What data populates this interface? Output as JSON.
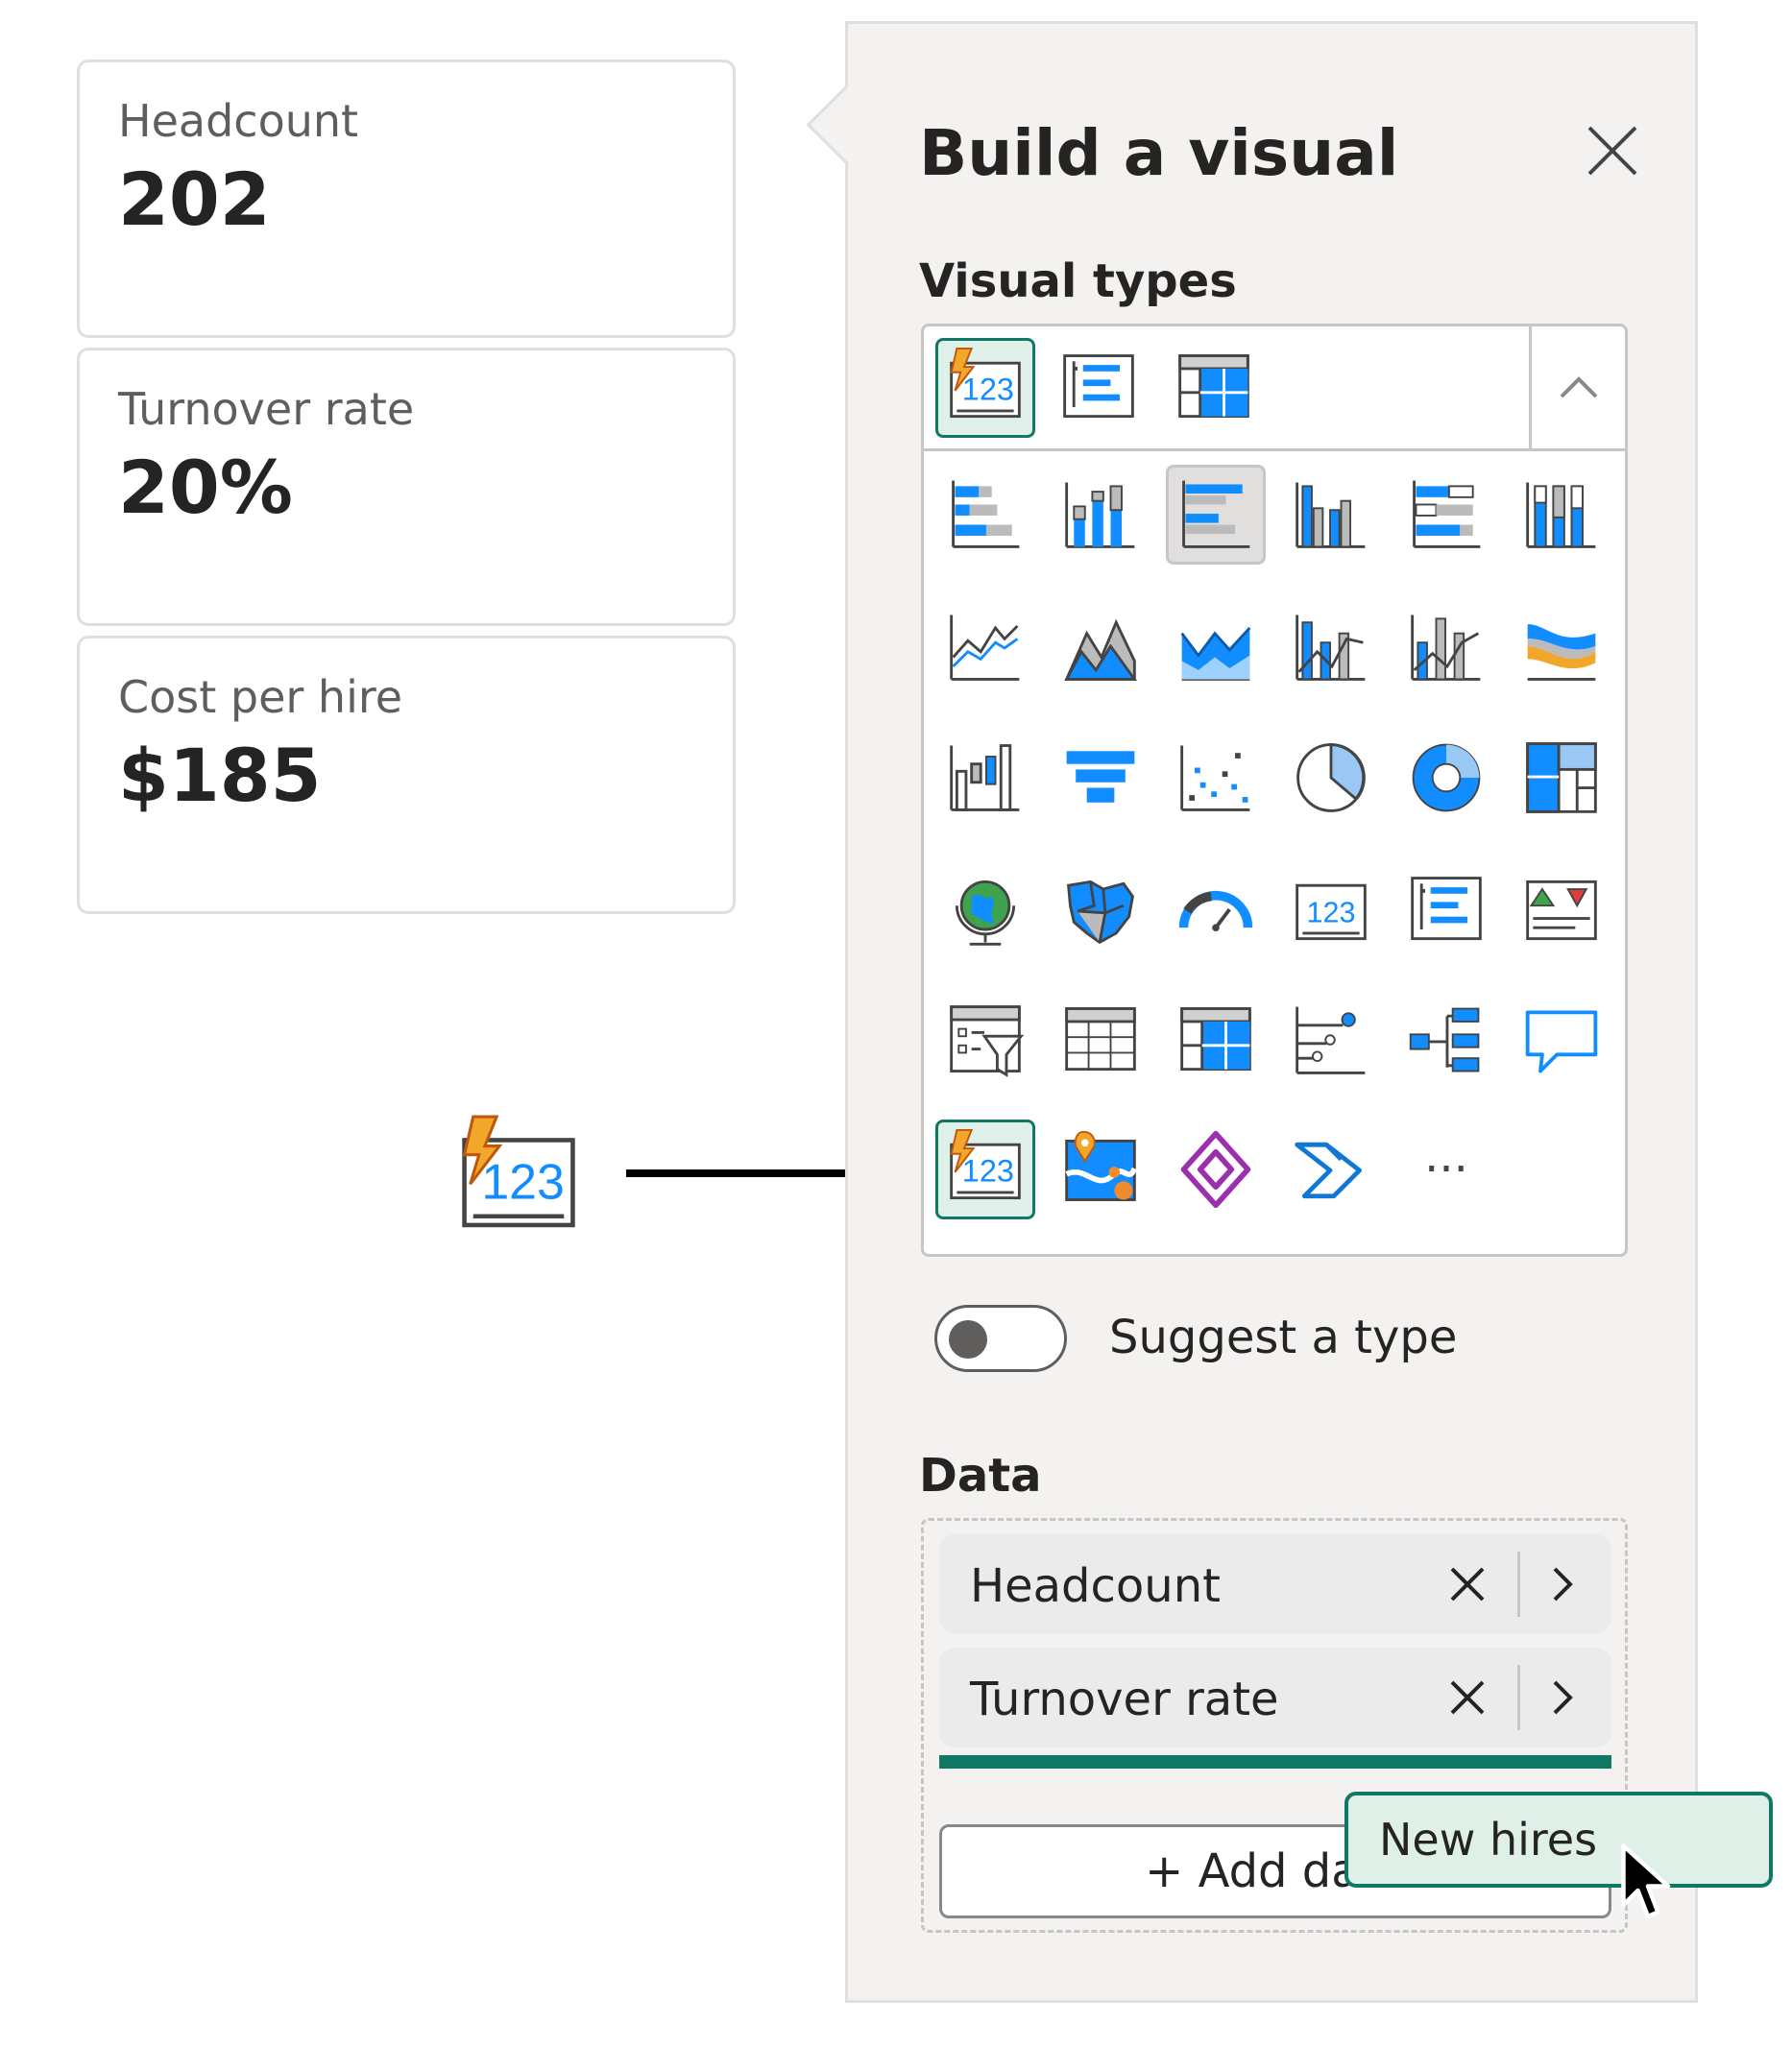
{
  "cards": [
    {
      "label": "Headcount",
      "value": "202"
    },
    {
      "label": "Turnover rate",
      "value": "20%"
    },
    {
      "label": "Cost per hire",
      "value": "$185"
    }
  ],
  "pane": {
    "title": "Build a visual",
    "visual_types_label": "Visual types",
    "suggest_label": "Suggest a type",
    "data_label": "Data",
    "more_label": "···"
  },
  "data_fields": [
    {
      "name": "Headcount"
    },
    {
      "name": "Turnover rate"
    }
  ],
  "add_button_label": "+ Add data",
  "drag_chip_label": "New hires",
  "icons": {
    "recent": [
      "kpi-card-icon",
      "multi-row-card-icon",
      "matrix-icon"
    ],
    "gallery": [
      "stacked-bar-chart-icon",
      "stacked-column-chart-icon",
      "clustered-bar-chart-icon",
      "clustered-column-chart-icon",
      "100-stacked-bar-chart-icon",
      "100-stacked-column-chart-icon",
      "line-chart-icon",
      "area-chart-icon",
      "stacked-area-chart-icon",
      "line-and-stacked-column-icon",
      "line-and-clustered-column-icon",
      "ribbon-chart-icon",
      "waterfall-chart-icon",
      "funnel-chart-icon",
      "scatter-chart-icon",
      "pie-chart-icon",
      "donut-chart-icon",
      "treemap-icon",
      "map-icon",
      "filled-map-icon",
      "gauge-icon",
      "card-icon",
      "multi-row-card-icon",
      "kpi-icon",
      "slicer-icon",
      "table-icon",
      "matrix-icon",
      "key-influencers-icon",
      "decomposition-tree-icon",
      "qa-icon",
      "new-card-icon",
      "azure-map-icon",
      "power-apps-icon",
      "power-automate-icon"
    ]
  },
  "colors": {
    "accent": "#117865",
    "blue": "#118dff",
    "pane_bg": "#f3f2f1"
  }
}
